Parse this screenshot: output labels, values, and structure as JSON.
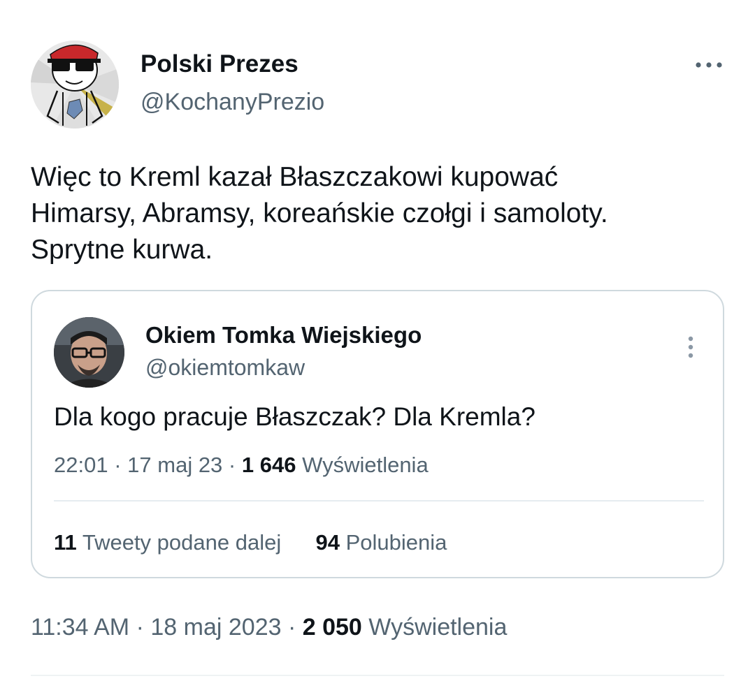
{
  "tweet": {
    "author": {
      "display_name": "Polski Prezes",
      "handle": "@KochanyPrezio",
      "avatar": "cartoon-avatar-with-sunglasses-and-red-cap"
    },
    "more_icon": "ellipsis-horizontal-icon",
    "text": "Więc to Kreml kazał Błaszczakowi kupować\nHimarsy, Abramsy, koreańskie czołgi i samoloty.\nSprytne kurwa.",
    "time": "11:34 AM",
    "date": "18 maj 2023",
    "separator": "·",
    "views_count": "2 050",
    "views_label": "Wyświetlenia"
  },
  "quoted_tweet": {
    "author": {
      "display_name": "Okiem Tomka Wiejskiego",
      "handle": "@okiemtomkaw",
      "avatar": "photo-avatar-man-with-glasses"
    },
    "more_icon": "ellipsis-vertical-icon",
    "text": "Dla kogo pracuje Błaszczak? Dla Kremla?",
    "time": "22:01",
    "date": "17 maj 23",
    "separator": "·",
    "views_count": "1 646",
    "views_label": "Wyświetlenia",
    "retweets_count": "11",
    "retweets_label": "Tweety podane dalej",
    "likes_count": "94",
    "likes_label": "Polubienia"
  },
  "colors": {
    "primary_text": "#0f1419",
    "secondary_text": "#536471",
    "border": "#cfd9de",
    "accent_cap": "#c8282b"
  }
}
